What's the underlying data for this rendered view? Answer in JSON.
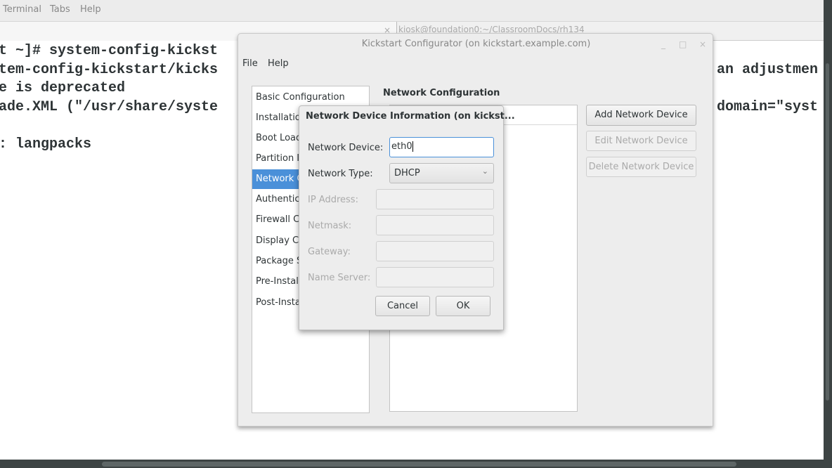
{
  "terminal": {
    "menu": [
      "Terminal",
      "Tabs",
      "Help"
    ],
    "tab2_title": "kiosk@foundation0:~/ClassroomDocs/rh134",
    "tab_close": "×",
    "lines": [
      "t ~]# system-config-kickst",
      "tem-config-kickstart/kicks",
      "e is deprecated",
      "ade.XML (\"/usr/share/syste",
      "",
      ": langpacks"
    ],
    "right_lines": [
      "an adjustmen",
      "domain=\"syst"
    ]
  },
  "kickstart": {
    "title": "Kickstart Configurator (on kickstart.example.com)",
    "controls": [
      "_",
      "□",
      "×"
    ],
    "menu": [
      "File",
      "Help"
    ],
    "sidebar": [
      "Basic Configuration",
      "Installation Method",
      "Boot Loader Options",
      "Partition Information",
      "Network Configuration",
      "Authentication",
      "Firewall Configuration",
      "Display Configuration",
      "Package Selection",
      "Pre-Installation Script",
      "Post-Installation Script"
    ],
    "selected_index": 4,
    "section_title": "Network Configuration",
    "buttons": {
      "add": "Add Network Device",
      "edit": "Edit Network Device",
      "delete": "Delete Network Device"
    }
  },
  "dialog": {
    "title": "Network Device Information (on kickst...",
    "device_label": "Network Device:",
    "device_value": "eth0",
    "type_label": "Network Type:",
    "type_value": "DHCP",
    "ip_label": "IP Address:",
    "netmask_label": "Netmask:",
    "gateway_label": "Gateway:",
    "nameserver_label": "Name Server:",
    "cancel": "Cancel",
    "ok": "OK"
  },
  "colors": {
    "selection": "#4a90d9"
  }
}
